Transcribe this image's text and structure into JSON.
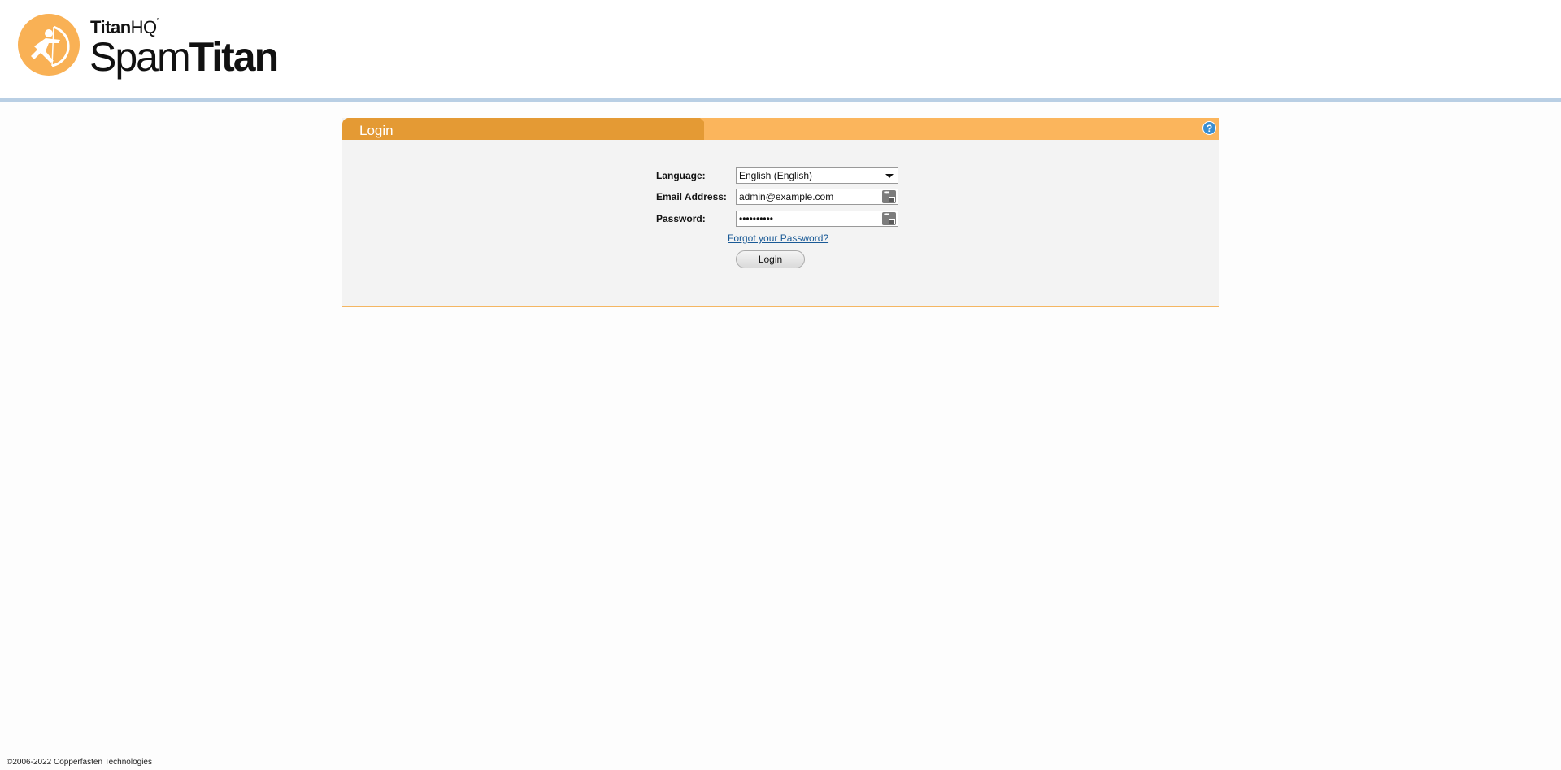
{
  "brand": {
    "company_prefix": "Titan",
    "company_suffix": "HQ",
    "trademark": "°",
    "product_prefix": "Spam",
    "product_suffix": "Titan"
  },
  "colors": {
    "accent_orange": "#fbb55c",
    "accent_orange_dark": "#e49a34",
    "header_rule": "#b9cfe4",
    "link": "#1a5a96"
  },
  "login_panel": {
    "title": "Login",
    "help_icon": "?",
    "language": {
      "label": "Language:",
      "selected": "English (English)"
    },
    "email": {
      "label": "Email Address:",
      "value": "admin@example.com"
    },
    "password": {
      "label": "Password:",
      "value": "••••••••••"
    },
    "forgot_link": "Forgot your Password?",
    "submit_label": "Login"
  },
  "footer": {
    "copyright": "©2006-2022 Copperfasten Technologies"
  }
}
